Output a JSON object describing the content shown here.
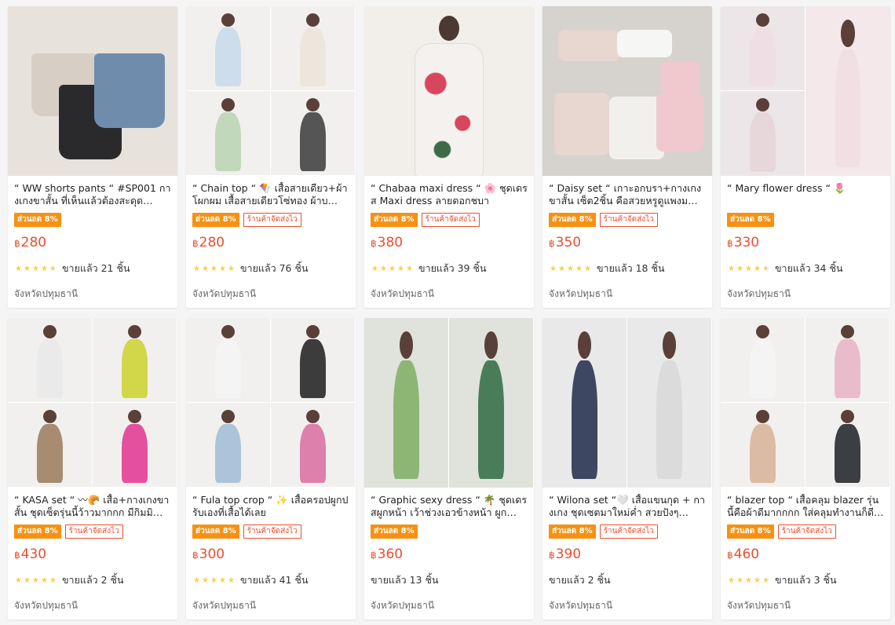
{
  "products": [
    {
      "title": "“ WW shorts pants “ #SP001 กางเกงขาสั้น ที่เห็นแล้วต้องสะดุด…",
      "discount": "ส่วนลด 8%",
      "fast_ship": "",
      "currency": "฿",
      "price": "280",
      "rating_stars": 4.5,
      "sold": "ขายแล้ว 21 ชิ้น",
      "location": "จังหวัดปทุมธานี",
      "thumb_colors": [
        "#e8e2dc",
        "#d7cfc6",
        "#2a2a2c",
        "#6f8cad"
      ],
      "layout": "single"
    },
    {
      "title": "“ Chain top “ 🪁 เสื้อสายเดียว+ผ้าโผกผม เสื้อสายเดียวโซ่ทอง ผ้าบ…",
      "discount": "ส่วนลด 8%",
      "fast_ship": "ร้านค้าจัดส่งไว",
      "currency": "฿",
      "price": "280",
      "rating_stars": 5,
      "sold": "ขายแล้ว 76 ชิ้น",
      "location": "จังหวัดปทุมธานี",
      "thumb_colors": [
        "#c7d9ea",
        "#ece4d8",
        "#b9d3b0",
        "#3a3a3a"
      ],
      "layout": "quad"
    },
    {
      "title": "“ Chabaa maxi dress “ 🌸 ชุดเดรส Maxi dress ลายดอกชบา",
      "discount": "ส่วนลด 8%",
      "fast_ship": "ร้านค้าจัดส่งไว",
      "currency": "฿",
      "price": "380",
      "rating_stars": 5,
      "sold": "ขายแล้ว 39 ชิ้น",
      "location": "จังหวัดปทุมธานี",
      "thumb_colors": [
        "#f2eeea",
        "#f4f1ee",
        "#d8465d",
        "#3d6b47"
      ],
      "layout": "single"
    },
    {
      "title": "“ Daisy set “ เกาะอกบรา+กางเกงขาสั้น เซ็ต2ชิ้น คือสวยหรูดูแพงม…",
      "discount": "ส่วนลด 8%",
      "fast_ship": "ร้านค้าจัดส่งไว",
      "currency": "฿",
      "price": "350",
      "rating_stars": 5,
      "sold": "ขายแล้ว 18 ชิ้น",
      "location": "จังหวัดปทุมธานี",
      "thumb_colors": [
        "#d6d2cd",
        "#e8d6d0",
        "#f2f0ec",
        "#efc9cd"
      ],
      "layout": "single"
    },
    {
      "title": "“ Mary flower dress “ 🌷",
      "discount": "ส่วนลด 8%",
      "fast_ship": "",
      "currency": "฿",
      "price": "330",
      "rating_stars": 4.5,
      "sold": "ขายแล้ว 34 ชิ้น",
      "location": "จังหวัดปทุมธานี",
      "thumb_colors": [
        "#ece6e8",
        "#f0dde3",
        "#e6d3d8",
        "#f4e8eb"
      ],
      "layout": "triple"
    },
    {
      "title": "“ KASA set “ 〰🥐 เสื้อ+กางเกงขาสั้น ชุดเซ็ตรุ่นนี้ว้าวมากกก มีกิมมิ…",
      "discount": "ส่วนลด 8%",
      "fast_ship": "ร้านค้าจัดส่งไว",
      "currency": "฿",
      "price": "430",
      "rating_stars": 5,
      "sold": "ขายแล้ว 2 ชิ้น",
      "location": "จังหวัดปทุมธานี",
      "thumb_colors": [
        "#e9e9ea",
        "#cbd22a",
        "#9a7a5a",
        "#e2348f"
      ],
      "layout": "quad"
    },
    {
      "title": "“ Fula top crop “ ✨ เสื้อครอปผูกปรับเองที่เสื้อได้เลย",
      "discount": "ส่วนลด 8%",
      "fast_ship": "ร้านค้าจัดส่งไว",
      "currency": "฿",
      "price": "300",
      "rating_stars": 5,
      "sold": "ขายแล้ว 41 ชิ้น",
      "location": "จังหวัดปทุมธานี",
      "thumb_colors": [
        "#f4f4f4",
        "#1c1c1c",
        "#9fbcd6",
        "#d96ca0"
      ],
      "layout": "quad"
    },
    {
      "title": "“ Graphic sexy dress “ 🌴 ชุดเดรสผูกหน้า เว้าช่วงเอวข้างหน้า ผูก…",
      "discount": "ส่วนลด 8%",
      "fast_ship": "",
      "currency": "฿",
      "price": "360",
      "rating_stars": 0,
      "sold": "ขายแล้ว 13 ชิ้น",
      "location": "จังหวัดปทุมธานี",
      "thumb_colors": [
        "#dfe3db",
        "#7fae63",
        "#e5a46a",
        "#2f6b42"
      ],
      "layout": "double"
    },
    {
      "title": "“ Wilona set “🤍 เสื้อแขนกุด + กางเกง ชุดเซตมาใหม่ค่ำ สวยปังๆ…",
      "discount": "ส่วนลด 8%",
      "fast_ship": "ร้านค้าจัดส่งไว",
      "currency": "฿",
      "price": "390",
      "rating_stars": 0,
      "sold": "ขายแล้ว 2 ชิ้น",
      "location": "จังหวัดปทุมธานี",
      "thumb_colors": [
        "#e9e9e9",
        "#1f2a4a",
        "#f4f4f4",
        "#d8d8d8"
      ],
      "layout": "double"
    },
    {
      "title": "“ blazer top “ เสื้อคลุม blazer รุ่นนี้คือผ้าดีมากกกก ใส่คลุมทำงานก็ดีอ…",
      "discount": "ส่วนลด 8%",
      "fast_ship": "ร้านค้าจัดส่งไว",
      "currency": "฿",
      "price": "460",
      "rating_stars": 5,
      "sold": "ขายแล้ว 3 ชิ้น",
      "location": "จังหวัดปทุมธานี",
      "thumb_colors": [
        "#f4f4f4",
        "#e7b3c6",
        "#d8b196",
        "#1d1e24"
      ],
      "layout": "quad"
    }
  ]
}
